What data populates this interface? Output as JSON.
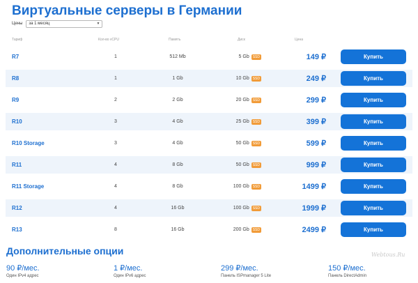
{
  "title": "Виртуальные серверы в Германии",
  "price_filter": {
    "label": "Цены",
    "selected": "за 1 месяц"
  },
  "columns": {
    "plan": "Тариф",
    "vcpu": "Кол-во vCPU",
    "ram": "Память",
    "disk": "Диск",
    "price": "Цена"
  },
  "ssd_label": "SSD",
  "buy_label": "Купить",
  "plans": [
    {
      "name": "R7",
      "vcpu": "1",
      "ram": "512 Mb",
      "disk": "5 Gb",
      "price": "149 ₽"
    },
    {
      "name": "R8",
      "vcpu": "1",
      "ram": "1 Gb",
      "disk": "10 Gb",
      "price": "249 ₽"
    },
    {
      "name": "R9",
      "vcpu": "2",
      "ram": "2 Gb",
      "disk": "20 Gb",
      "price": "299 ₽"
    },
    {
      "name": "R10",
      "vcpu": "3",
      "ram": "4 Gb",
      "disk": "25 Gb",
      "price": "399 ₽"
    },
    {
      "name": "R10 Storage",
      "vcpu": "3",
      "ram": "4 Gb",
      "disk": "50 Gb",
      "price": "599 ₽"
    },
    {
      "name": "R11",
      "vcpu": "4",
      "ram": "8 Gb",
      "disk": "50 Gb",
      "price": "999 ₽"
    },
    {
      "name": "R11 Storage",
      "vcpu": "4",
      "ram": "8 Gb",
      "disk": "100 Gb",
      "price": "1499 ₽"
    },
    {
      "name": "R12",
      "vcpu": "4",
      "ram": "16 Gb",
      "disk": "100 Gb",
      "price": "1999 ₽"
    },
    {
      "name": "R13",
      "vcpu": "8",
      "ram": "16 Gb",
      "disk": "200 Gb",
      "price": "2499 ₽"
    }
  ],
  "options_title": "Дополнительные опции",
  "options": [
    {
      "price": "90 ₽/мес.",
      "desc": "Один IPv4 адрес"
    },
    {
      "price": "1 ₽/мес.",
      "desc": "Один IPv6 адрес"
    },
    {
      "price": "299 ₽/мес.",
      "desc": "Панель ISPmanager 5 Lite"
    },
    {
      "price": "150 ₽/мес.",
      "desc": "Панель DirectAdmin"
    }
  ],
  "watermark": "Webtous.Ru"
}
